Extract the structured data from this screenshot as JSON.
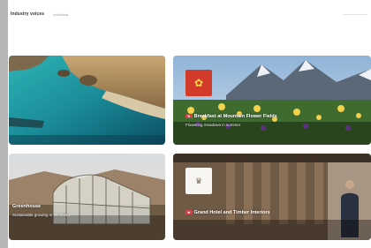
{
  "header": {
    "title": "Industry voices",
    "subtitle": "Individual"
  },
  "cards": [
    {
      "name": "coastal-cove-card",
      "title": "",
      "subtitle": ""
    },
    {
      "name": "alpine-meadow-card",
      "badge": "★",
      "title": "Breakfast at Mountain Flower Fields",
      "subtitle": "Flowering meadows in summer"
    },
    {
      "name": "greenhouse-card",
      "title": "Greenhouse",
      "subtitle": "Sustainable growing in the valley"
    },
    {
      "name": "hotel-lobby-card",
      "badge": "★",
      "title": "Grand Hotel and Timber Interiors",
      "subtitle": ""
    }
  ]
}
